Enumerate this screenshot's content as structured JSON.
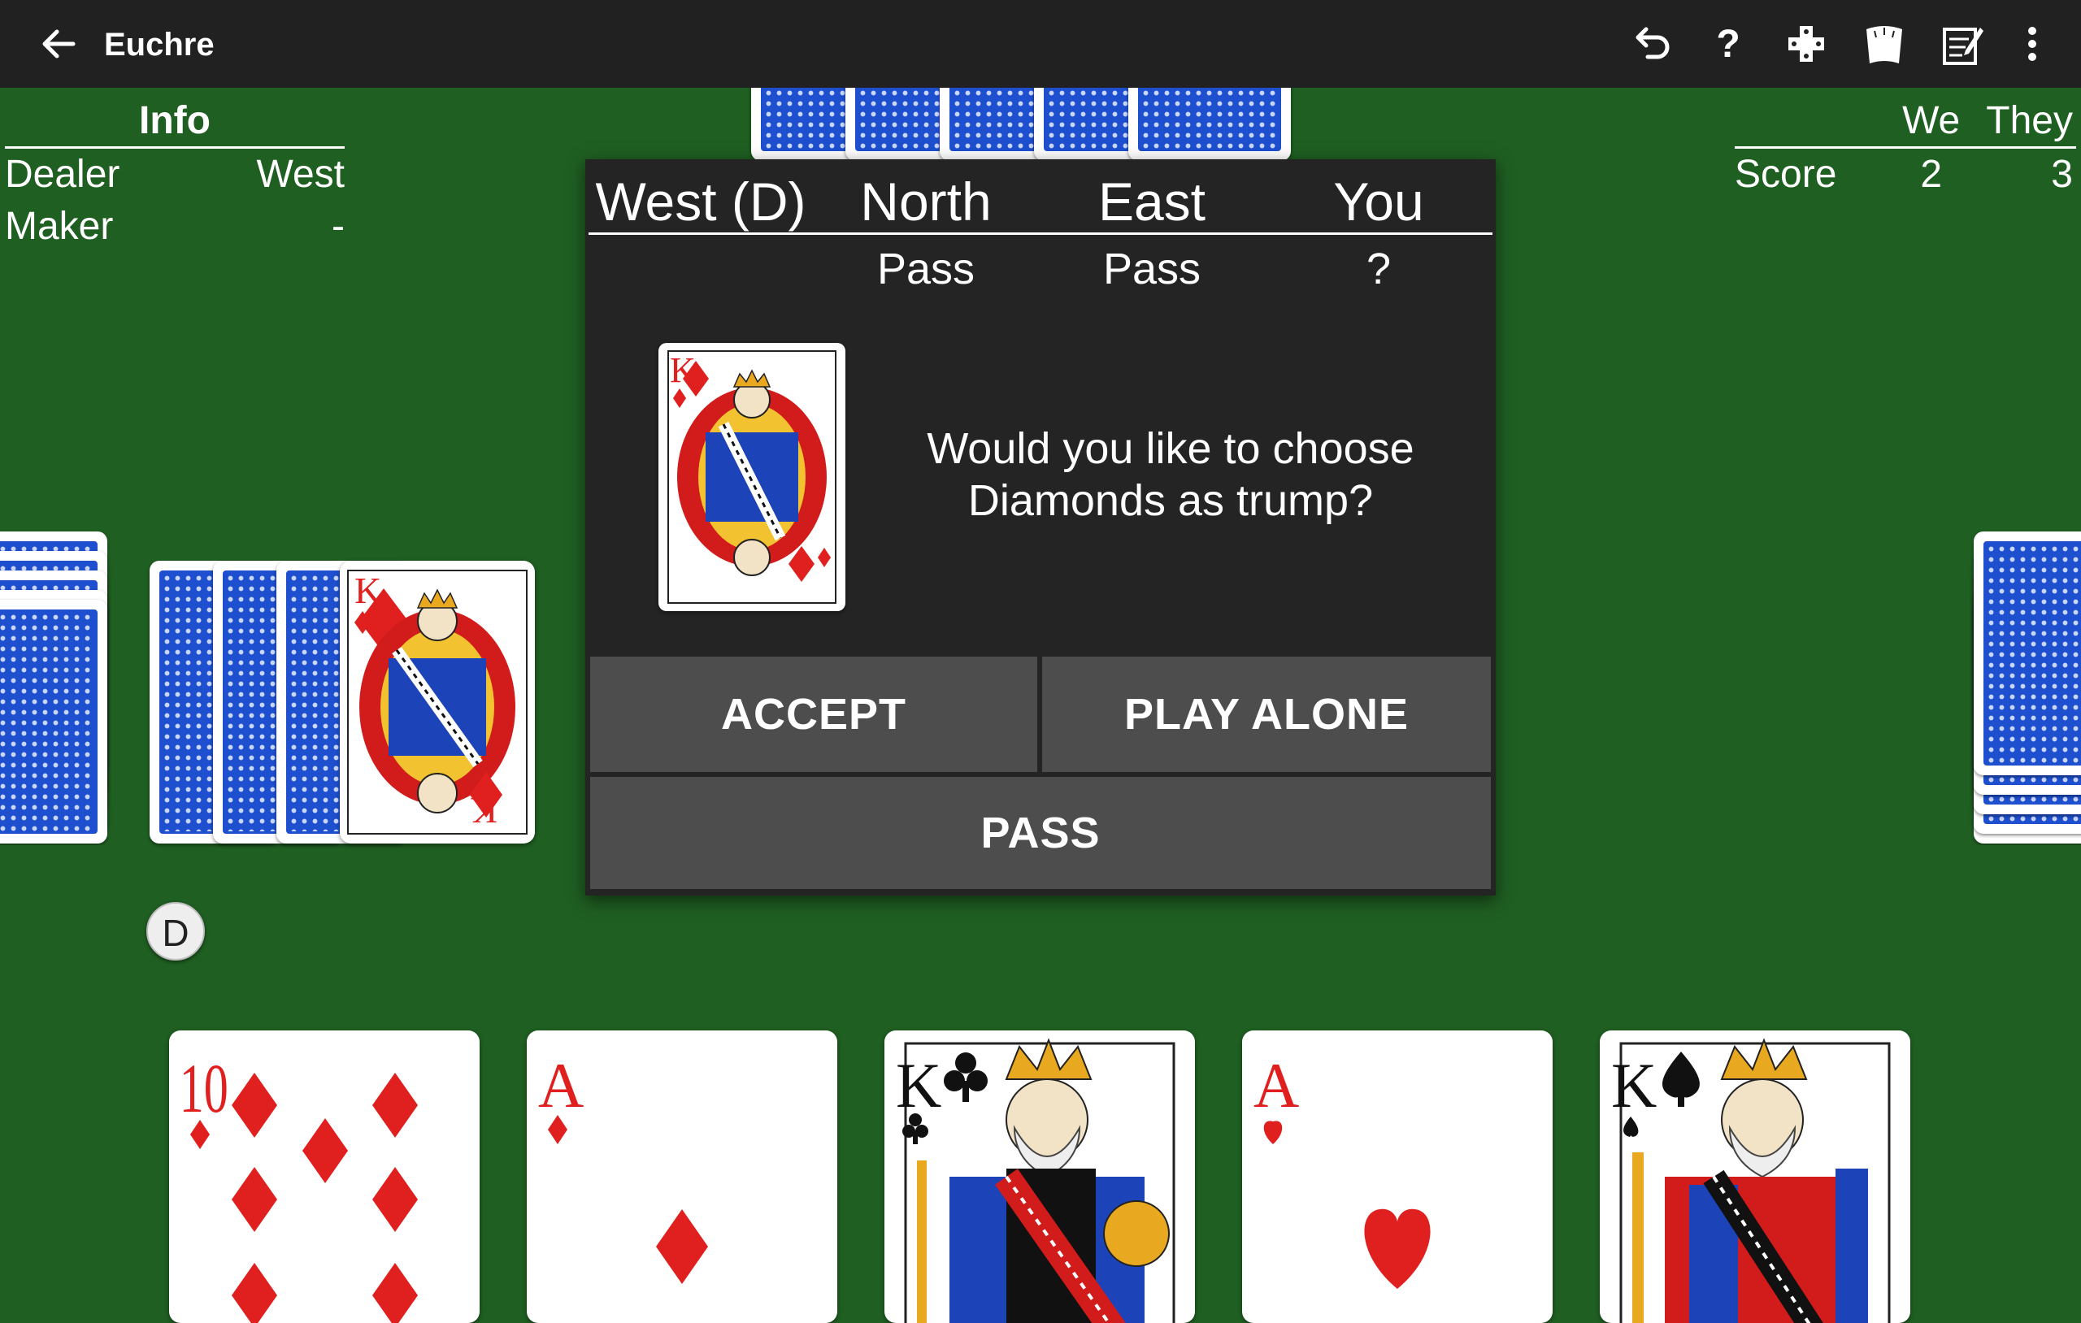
{
  "app": {
    "title": "Euchre"
  },
  "toolbar": {
    "icons": [
      "back-arrow-icon",
      "undo-icon",
      "help-icon",
      "game-controller-icon",
      "cards-icon",
      "scoresheet-icon",
      "more-vert-icon"
    ],
    "help_glyph": "?"
  },
  "info": {
    "header": "Info",
    "rows": [
      {
        "label": "Dealer",
        "value": "West"
      },
      {
        "label": "Maker",
        "value": "-"
      }
    ]
  },
  "score": {
    "headers": [
      "",
      "We",
      "They"
    ],
    "row_label": "Score",
    "we": "2",
    "they": "3"
  },
  "bidding": {
    "players": [
      "West (D)",
      "North",
      "East",
      "You"
    ],
    "bids": [
      "",
      "Pass",
      "Pass",
      "?"
    ]
  },
  "dialog": {
    "question": "Would you like to choose Diamonds as trump?",
    "upcard": {
      "rank": "K",
      "suit": "diamonds",
      "color": "#e0201f"
    },
    "buttons": {
      "accept": "ACCEPT",
      "play_alone": "PLAY ALONE",
      "pass": "PASS"
    }
  },
  "dealer_badge": "D",
  "west_hand": {
    "backs": 3,
    "face_card": {
      "rank": "K",
      "suit": "diamonds"
    }
  },
  "player_hand": [
    {
      "rank": "10",
      "suit": "diamonds",
      "color": "#e0201f"
    },
    {
      "rank": "A",
      "suit": "diamonds",
      "color": "#e0201f"
    },
    {
      "rank": "K",
      "suit": "clubs",
      "color": "#111111"
    },
    {
      "rank": "A",
      "suit": "hearts",
      "color": "#e0201f"
    },
    {
      "rank": "K",
      "suit": "spades",
      "color": "#111111"
    }
  ],
  "colors": {
    "table": "#1f5f22",
    "appbar": "#212121",
    "dialog": "#242424",
    "button": "#4d4d4d",
    "card_back": "#1d4fcf"
  }
}
